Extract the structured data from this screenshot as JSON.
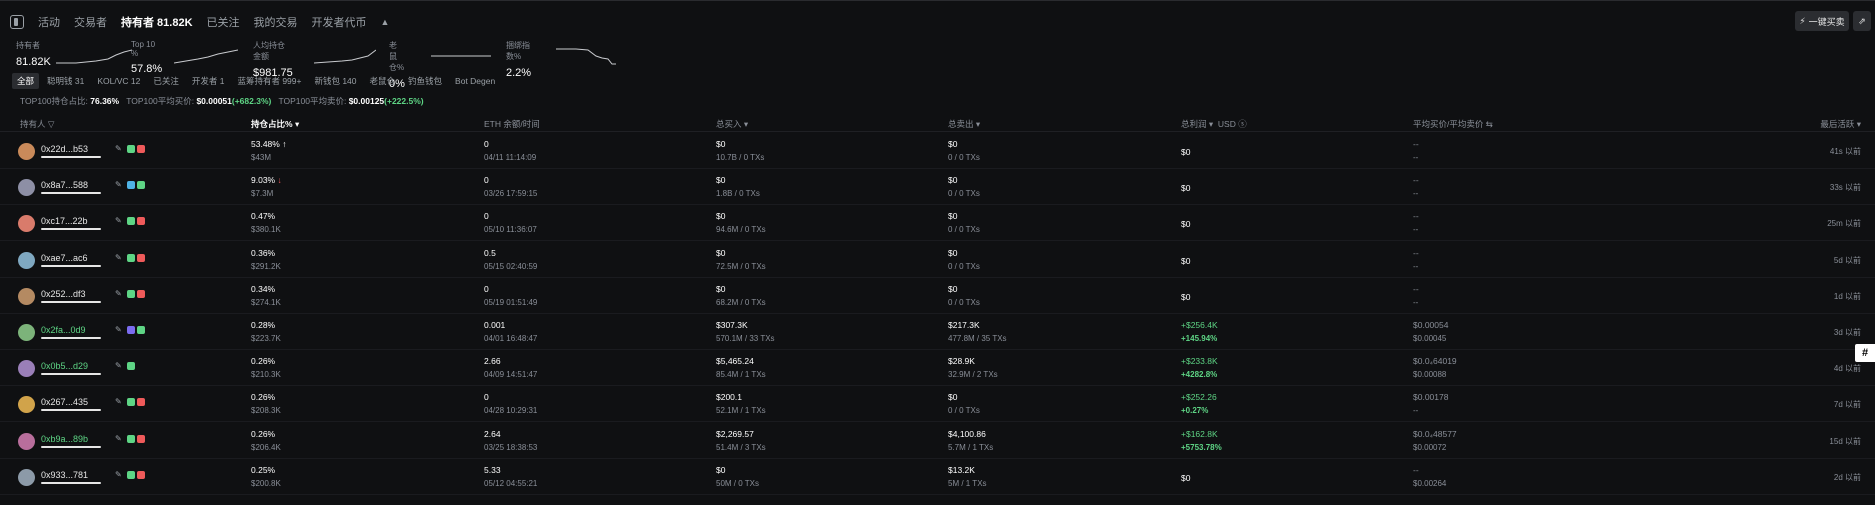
{
  "tabs": [
    {
      "label": "活动"
    },
    {
      "label": "交易者"
    },
    {
      "label": "持有者 81.82K"
    },
    {
      "label": "已关注"
    },
    {
      "label": "我的交易"
    },
    {
      "label": "开发者代币"
    }
  ],
  "actions": {
    "buy_label": "一键买卖"
  },
  "stats": [
    {
      "label": "持有者",
      "value": "81.82K"
    },
    {
      "label": "Top 10 %",
      "value": "57.8%"
    },
    {
      "label": "人均持仓金额",
      "value": "$981.75"
    },
    {
      "label": "老鼠仓%",
      "value": "0%"
    },
    {
      "label": "捆绑指数%",
      "value": "2.2%"
    }
  ],
  "filters": [
    "全部",
    "聪明钱 31",
    "KOL/VC 12",
    "已关注",
    "开发者 1",
    "蓝筹持有者 999+",
    "新钱包 140",
    "老鼠仓",
    "钓鱼钱包",
    "Bot Degen"
  ],
  "summary": {
    "label1": "TOP100持仓占比:",
    "value1": "76.36%",
    "label2": "TOP100平均买价:",
    "value2": "$0.00051",
    "change2": "(+682.3%)",
    "label3": "TOP100平均卖价:",
    "value3": "$0.00125",
    "change3": "(+222.5%)"
  },
  "headers": {
    "holder": "持有人",
    "share": "持仓占比%",
    "eth": "ETH 余额/时间",
    "bought": "总买入",
    "sold": "总卖出",
    "pnl": "总利润",
    "currency": "USD",
    "avg": "平均买价/平均卖价",
    "last": "最后活跃"
  },
  "rows": [
    {
      "addr": "0x22d...b53",
      "green": false,
      "share": "53.48%",
      "share_arrow": "↑",
      "share_usd": "$43M",
      "eth": "0",
      "time": "04/11 11:14:09",
      "buy": "$0",
      "buy_sub": "10.7B / 0 TXs",
      "sell": "$0",
      "sell_sub": "0 / 0 TXs",
      "pnl": "$0",
      "pnl_pct": "",
      "avg_buy": "--",
      "avg_sell": "--",
      "last": "41s 以前"
    },
    {
      "addr": "0x8a7...588",
      "green": false,
      "share": "9.03%",
      "share_arrow": "↓",
      "share_usd": "$7.3M",
      "eth": "0",
      "time": "03/26 17:59:15",
      "buy": "$0",
      "buy_sub": "1.8B / 0 TXs",
      "sell": "$0",
      "sell_sub": "0 / 0 TXs",
      "pnl": "$0",
      "pnl_pct": "",
      "avg_buy": "--",
      "avg_sell": "--",
      "last": "33s 以前"
    },
    {
      "addr": "0xc17...22b",
      "green": false,
      "share": "0.47%",
      "share_arrow": "",
      "share_usd": "$380.1K",
      "eth": "0",
      "time": "05/10 11:36:07",
      "buy": "$0",
      "buy_sub": "94.6M / 0 TXs",
      "sell": "$0",
      "sell_sub": "0 / 0 TXs",
      "pnl": "$0",
      "pnl_pct": "",
      "avg_buy": "--",
      "avg_sell": "--",
      "last": "25m 以前"
    },
    {
      "addr": "0xae7...ac6",
      "green": false,
      "share": "0.36%",
      "share_arrow": "",
      "share_usd": "$291.2K",
      "eth": "0.5",
      "time": "05/15 02:40:59",
      "buy": "$0",
      "buy_sub": "72.5M / 0 TXs",
      "sell": "$0",
      "sell_sub": "0 / 0 TXs",
      "pnl": "$0",
      "pnl_pct": "",
      "avg_buy": "--",
      "avg_sell": "--",
      "last": "5d 以前"
    },
    {
      "addr": "0x252...df3",
      "green": false,
      "share": "0.34%",
      "share_arrow": "",
      "share_usd": "$274.1K",
      "eth": "0",
      "time": "05/19 01:51:49",
      "buy": "$0",
      "buy_sub": "68.2M / 0 TXs",
      "sell": "$0",
      "sell_sub": "0 / 0 TXs",
      "pnl": "$0",
      "pnl_pct": "",
      "avg_buy": "--",
      "avg_sell": "--",
      "last": "1d 以前"
    },
    {
      "addr": "0x2fa...0d9",
      "green": true,
      "share": "0.28%",
      "share_arrow": "",
      "share_usd": "$223.7K",
      "eth": "0.001",
      "time": "04/01 16:48:47",
      "buy": "$307.3K",
      "buy_sub": "570.1M / 33 TXs",
      "sell": "$217.3K",
      "sell_sub": "477.8M / 35 TXs",
      "pnl": "+$256.4K",
      "pnl_pct": "+145.94%",
      "avg_buy": "$0.00054",
      "avg_sell": "$0.00045",
      "last": "3d 以前"
    },
    {
      "addr": "0x0b5...d29",
      "green": true,
      "share": "0.26%",
      "share_arrow": "",
      "share_usd": "$210.3K",
      "eth": "2.66",
      "time": "04/09 14:51:47",
      "buy": "$5,465.24",
      "buy_sub": "85.4M / 1 TXs",
      "sell": "$28.9K",
      "sell_sub": "32.9M / 2 TXs",
      "pnl": "+$233.8K",
      "pnl_pct": "+4282.8%",
      "avg_buy": "$0.0₄64019",
      "avg_sell": "$0.00088",
      "last": "4d 以前"
    },
    {
      "addr": "0x267...435",
      "green": false,
      "share": "0.26%",
      "share_arrow": "",
      "share_usd": "$208.3K",
      "eth": "0",
      "time": "04/28 10:29:31",
      "buy": "$200.1",
      "buy_sub": "52.1M / 1 TXs",
      "sell": "$0",
      "sell_sub": "0 / 0 TXs",
      "pnl": "+$252.26",
      "pnl_pct": "+0.27%",
      "avg_buy": "$0.00178",
      "avg_sell": "--",
      "last": "7d 以前"
    },
    {
      "addr": "0xb9a...89b",
      "green": true,
      "share": "0.26%",
      "share_arrow": "",
      "share_usd": "$206.4K",
      "eth": "2.64",
      "time": "03/25 18:38:53",
      "buy": "$2,269.57",
      "buy_sub": "51.4M / 3 TXs",
      "sell": "$4,100.86",
      "sell_sub": "5.7M / 1 TXs",
      "pnl": "+$162.8K",
      "pnl_pct": "+5753.78%",
      "avg_buy": "$0.0₄48577",
      "avg_sell": "$0.00072",
      "last": "15d 以前"
    },
    {
      "addr": "0x933...781",
      "green": false,
      "share": "0.25%",
      "share_arrow": "",
      "share_usd": "$200.8K",
      "eth": "5.33",
      "time": "05/12 04:55:21",
      "buy": "$0",
      "buy_sub": "50M / 0 TXs",
      "sell": "$13.2K",
      "sell_sub": "5M / 1 TXs",
      "pnl": "$0",
      "pnl_pct": "",
      "avg_buy": "--",
      "avg_sell": "$0.00264",
      "last": "2d 以前"
    }
  ],
  "overlay": {
    "hash": "#"
  }
}
